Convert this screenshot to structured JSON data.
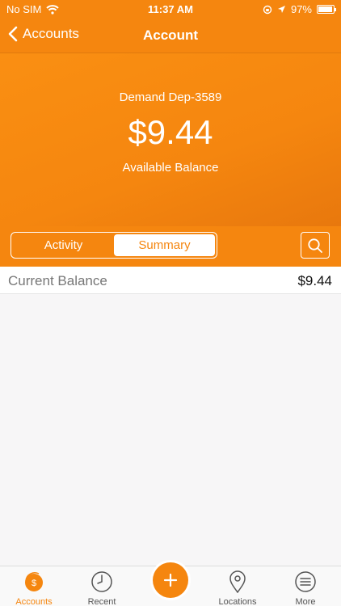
{
  "status_bar": {
    "carrier": "No SIM",
    "time": "11:37 AM",
    "battery_pct": "97%"
  },
  "nav": {
    "back_label": "Accounts",
    "title": "Account"
  },
  "account": {
    "name": "Demand Dep-3589",
    "balance": "$9.44",
    "balance_label": "Available Balance"
  },
  "tabs": [
    {
      "label": "Activity",
      "active": false
    },
    {
      "label": "Summary",
      "active": true
    }
  ],
  "summary": {
    "rows": [
      {
        "label": "Current Balance",
        "value": "$9.44"
      }
    ]
  },
  "tab_bar": {
    "items": [
      {
        "label": "Accounts",
        "icon": "accounts-icon",
        "active": true
      },
      {
        "label": "Recent",
        "icon": "clock-icon",
        "active": false
      },
      {
        "label": "",
        "icon": "plus-icon",
        "active": false
      },
      {
        "label": "Locations",
        "icon": "location-pin-icon",
        "active": false
      },
      {
        "label": "More",
        "icon": "menu-icon",
        "active": false
      }
    ]
  },
  "colors": {
    "accent": "#f5860f",
    "background": "#f7f6f7"
  }
}
